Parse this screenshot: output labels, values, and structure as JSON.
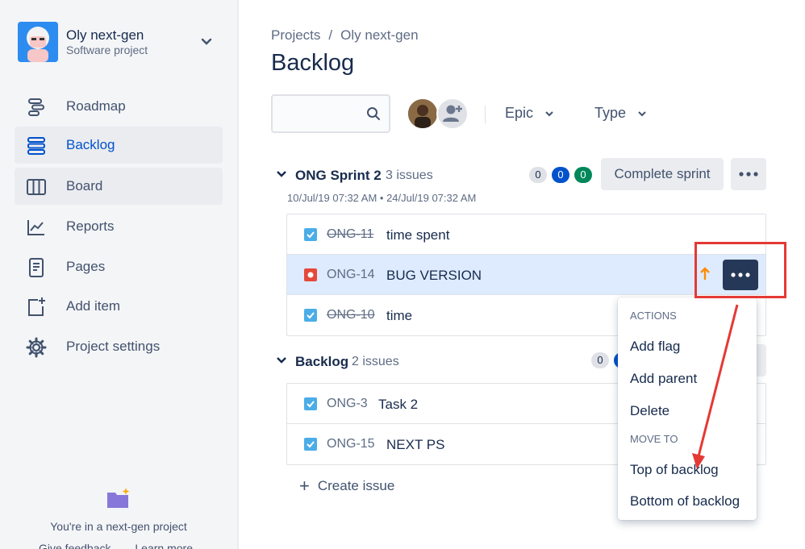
{
  "sidebar": {
    "project_name": "Oly next-gen",
    "project_type": "Software project",
    "items": [
      {
        "label": "Roadmap",
        "icon": "roadmap-icon"
      },
      {
        "label": "Backlog",
        "icon": "backlog-icon"
      },
      {
        "label": "Board",
        "icon": "board-icon"
      },
      {
        "label": "Reports",
        "icon": "reports-icon"
      },
      {
        "label": "Pages",
        "icon": "pages-icon"
      },
      {
        "label": "Add item",
        "icon": "add-item-icon"
      },
      {
        "label": "Project settings",
        "icon": "gear-icon"
      }
    ],
    "footer_text": "You're in a next-gen project",
    "footer_links": [
      "Give feedback",
      "Learn more"
    ]
  },
  "breadcrumb": {
    "root": "Projects",
    "separator": "/",
    "current": "Oly next-gen"
  },
  "page_title": "Backlog",
  "filters": {
    "epic": "Epic",
    "type": "Type"
  },
  "sprint": {
    "name": "ONG Sprint 2",
    "issue_count": "3 issues",
    "dates": "10/Jul/19 07:32 AM • 24/Jul/19 07:32 AM",
    "counts": [
      "0",
      "0",
      "0"
    ],
    "complete_label": "Complete sprint",
    "issues": [
      {
        "key": "ONG-11",
        "summary": "time spent",
        "type": "task",
        "done": true
      },
      {
        "key": "ONG-14",
        "summary": "BUG VERSION",
        "type": "bug",
        "done": false
      },
      {
        "key": "ONG-10",
        "summary": "time",
        "type": "task",
        "done": true
      }
    ]
  },
  "backlog": {
    "name": "Backlog",
    "issue_count": "2 issues",
    "counts": [
      "0"
    ],
    "issues": [
      {
        "key": "ONG-3",
        "summary": "Task 2",
        "type": "task"
      },
      {
        "key": "ONG-15",
        "summary": "NEXT PS",
        "type": "task"
      }
    ]
  },
  "create_issue": "Create issue",
  "menu": {
    "actions_heading": "ACTIONS",
    "add_flag": "Add flag",
    "add_parent": "Add parent",
    "delete": "Delete",
    "move_heading": "MOVE TO",
    "top": "Top of backlog",
    "bottom": "Bottom of backlog"
  },
  "colors": {
    "accent": "#0052cc",
    "annotation": "#e53935",
    "selected_row": "#deebff"
  }
}
